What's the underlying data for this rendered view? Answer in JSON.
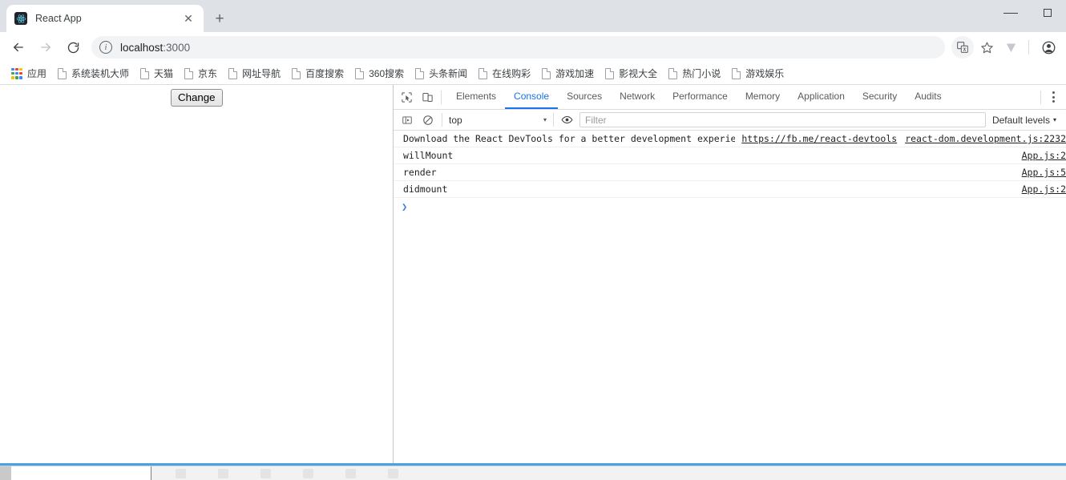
{
  "window": {
    "controls": {
      "minimize": "minimize-button",
      "maximize": "maximize-button"
    }
  },
  "tabs": [
    {
      "title": "React App",
      "favicon": "react-logo",
      "close_label": "✕"
    }
  ],
  "newtab_label": "+",
  "toolbar": {
    "back_label": "←",
    "forward_label": "→",
    "reload_label": "↻",
    "info_label": "i",
    "url_host": "localhost",
    "url_port": ":3000",
    "translate_icon": "translate-icon",
    "star_icon": "bookmark-star-icon",
    "extension_icon": "V",
    "profile_icon": "profile-avatar-icon"
  },
  "bookmarks": [
    {
      "label": "应用",
      "icon": "apps-grid-icon"
    },
    {
      "label": "系统装机大师",
      "icon": "page-icon"
    },
    {
      "label": "天猫",
      "icon": "page-icon"
    },
    {
      "label": "京东",
      "icon": "page-icon"
    },
    {
      "label": "网址导航",
      "icon": "page-icon"
    },
    {
      "label": "百度搜索",
      "icon": "page-icon"
    },
    {
      "label": "360搜索",
      "icon": "page-icon"
    },
    {
      "label": "头条新闻",
      "icon": "page-icon"
    },
    {
      "label": "在线购彩",
      "icon": "page-icon"
    },
    {
      "label": "游戏加速",
      "icon": "page-icon"
    },
    {
      "label": "影视大全",
      "icon": "page-icon"
    },
    {
      "label": "热门小说",
      "icon": "page-icon"
    },
    {
      "label": "游戏娱乐",
      "icon": "page-icon"
    }
  ],
  "page": {
    "change_button": "Change"
  },
  "devtools": {
    "inspect_icon": "inspect-element-icon",
    "device_icon": "device-toolbar-icon",
    "tabs": [
      {
        "label": "Elements",
        "active": false
      },
      {
        "label": "Console",
        "active": true
      },
      {
        "label": "Sources",
        "active": false
      },
      {
        "label": "Network",
        "active": false
      },
      {
        "label": "Performance",
        "active": false
      },
      {
        "label": "Memory",
        "active": false
      },
      {
        "label": "Application",
        "active": false
      },
      {
        "label": "Security",
        "active": false
      },
      {
        "label": "Audits",
        "active": false
      }
    ],
    "more_label": "kebab-menu",
    "console_toolbar": {
      "sidebar_icon": "console-sidebar-toggle-icon",
      "clear_icon": "clear-console-icon",
      "context": "top",
      "context_caret": "▾",
      "eye_icon": "live-expression-eye-icon",
      "filter_placeholder": "Filter",
      "levels_label": "Default levels",
      "levels_caret": "▾"
    },
    "messages": [
      {
        "text": "Download the React DevTools for a better development experience:",
        "link": "https://fb.me/react-devtools",
        "source": "react-dom.development.js:2232"
      },
      {
        "text": "willMount",
        "link": "",
        "source": "App.js:2"
      },
      {
        "text": "render",
        "link": "",
        "source": "App.js:5"
      },
      {
        "text": "didmount",
        "link": "",
        "source": "App.js:2"
      }
    ],
    "prompt_symbol": "❯"
  },
  "colors": {
    "accent": "#1a73e8",
    "tabstrip_bg": "#dee1e6",
    "toolbar_bg": "#ffffff",
    "omnibox_bg": "#f1f3f4",
    "window_border": "#4aa3df",
    "prompt": "#3b78e7"
  }
}
